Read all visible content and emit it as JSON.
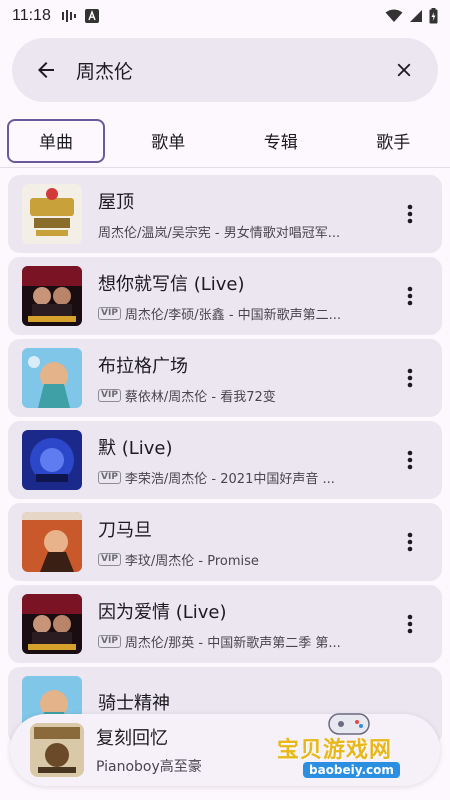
{
  "status": {
    "time": "11:18"
  },
  "search": {
    "query": "周杰伦"
  },
  "tabs": [
    {
      "label": "单曲"
    },
    {
      "label": "歌单"
    },
    {
      "label": "专辑"
    },
    {
      "label": "歌手"
    }
  ],
  "songs": [
    {
      "title": "屋顶",
      "vip": false,
      "subtitle": "周杰伦/温岚/吴宗宪 - 男女情歌对唱冠军..."
    },
    {
      "title": "想你就写信 (Live)",
      "vip": true,
      "subtitle": "周杰伦/李硕/张鑫 - 中国新歌声第二..."
    },
    {
      "title": "布拉格广场",
      "vip": true,
      "subtitle": "蔡依林/周杰伦 - 看我72变"
    },
    {
      "title": "默 (Live)",
      "vip": true,
      "subtitle": "李荣浩/周杰伦 - 2021中国好声音 ..."
    },
    {
      "title": "刀马旦",
      "vip": true,
      "subtitle": "李玟/周杰伦 - Promise"
    },
    {
      "title": "因为爱情 (Live)",
      "vip": true,
      "subtitle": "周杰伦/那英 - 中国新歌声第二季 第..."
    },
    {
      "title": "骑士精神",
      "vip": false,
      "subtitle": ""
    }
  ],
  "vip_label": "VIP",
  "player": {
    "title": "复刻回忆",
    "artist": "Pianoboy高至豪"
  },
  "watermark": {
    "text": "宝贝游戏网",
    "url": "baobeiy.com"
  },
  "colors": {
    "accent": "#6b5a9b",
    "card": "#ece6f0",
    "background": "#fdf8fd"
  }
}
